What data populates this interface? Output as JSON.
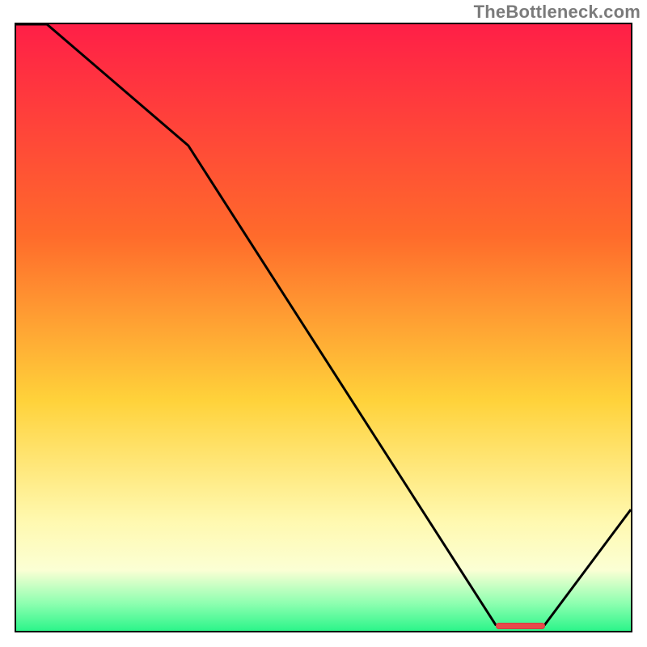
{
  "watermark": "TheBottleneck.com",
  "colors": {
    "gradient_top": "#ff1f47",
    "gradient_mid1": "#ff6b2b",
    "gradient_mid2": "#ffd23a",
    "gradient_low": "#fff9b0",
    "gradient_band": "#fbffd4",
    "gradient_green_lt": "#8dffb0",
    "gradient_green": "#2cf58a",
    "line_color": "#000000",
    "marker_color": "#e94a4a"
  },
  "chart_data": {
    "type": "line",
    "title": "",
    "xlabel": "",
    "ylabel": "",
    "xlim": [
      0,
      100
    ],
    "ylim": [
      0,
      100
    ],
    "x": [
      0,
      5,
      28,
      78,
      86,
      100
    ],
    "values": [
      100,
      100,
      80,
      1,
      1,
      20
    ],
    "marker": {
      "x0": 78,
      "x1": 86,
      "y": 0.5
    },
    "gradient_stops": [
      {
        "offset": 0.0,
        "key": "gradient_top"
      },
      {
        "offset": 0.35,
        "key": "gradient_mid1"
      },
      {
        "offset": 0.62,
        "key": "gradient_mid2"
      },
      {
        "offset": 0.82,
        "key": "gradient_low"
      },
      {
        "offset": 0.9,
        "key": "gradient_band"
      },
      {
        "offset": 0.955,
        "key": "gradient_green_lt"
      },
      {
        "offset": 1.0,
        "key": "gradient_green"
      }
    ]
  }
}
